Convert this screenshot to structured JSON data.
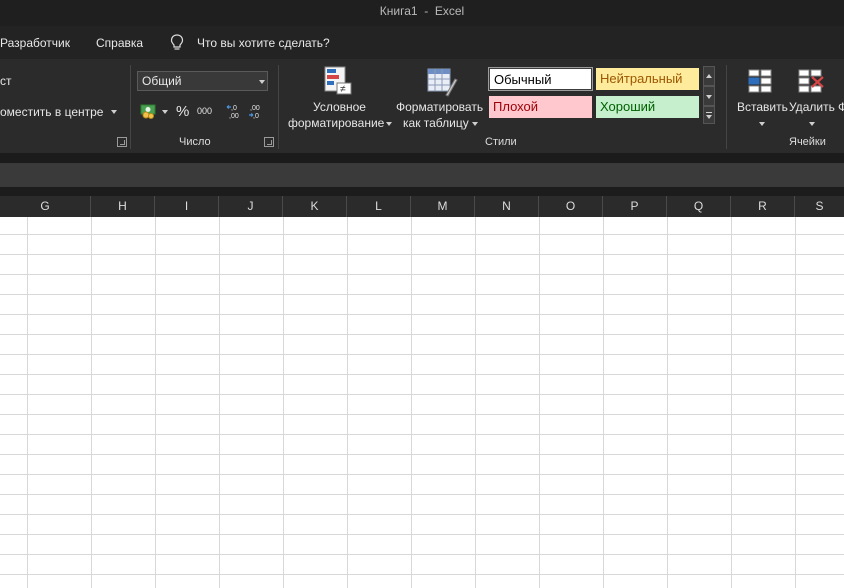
{
  "window": {
    "title": "Книга1  -  Excel"
  },
  "tabs": [
    {
      "label": "Разработчик"
    },
    {
      "label": "Справка"
    },
    {
      "label": "Что вы хотите сделать?"
    }
  ],
  "ribbon": {
    "alignment": {
      "wrap_partial": "ст",
      "merge_partial": "оместить в центре"
    },
    "number": {
      "format_value": "Общий",
      "percent": "%",
      "thousands": "000",
      "increase_decimal": "←,0 ,00",
      "decrease_decimal": ",00 →,0",
      "group_label": "Число"
    },
    "styles": {
      "conditional_line1": "Условное",
      "conditional_line2": "форматирование",
      "format_table_line1": "Форматировать",
      "format_table_line2": "как таблицу",
      "cells": [
        {
          "label": "Обычный",
          "bg": "#ffffff",
          "fg": "#000000"
        },
        {
          "label": "Нейтральный",
          "bg": "#ffeb9c",
          "fg": "#9c5700"
        },
        {
          "label": "Плохой",
          "bg": "#ffc7ce",
          "fg": "#9c0006"
        },
        {
          "label": "Хороший",
          "bg": "#c6efce",
          "fg": "#006100"
        }
      ],
      "group_label": "Стили"
    },
    "cells": {
      "insert_label": "Вставить",
      "delete_label": "Удалить",
      "format_partial": "Ф",
      "group_label": "Ячейки"
    }
  },
  "columns": [
    "G",
    "H",
    "I",
    "J",
    "K",
    "L",
    "M",
    "N",
    "O",
    "P",
    "Q",
    "R",
    "S"
  ]
}
